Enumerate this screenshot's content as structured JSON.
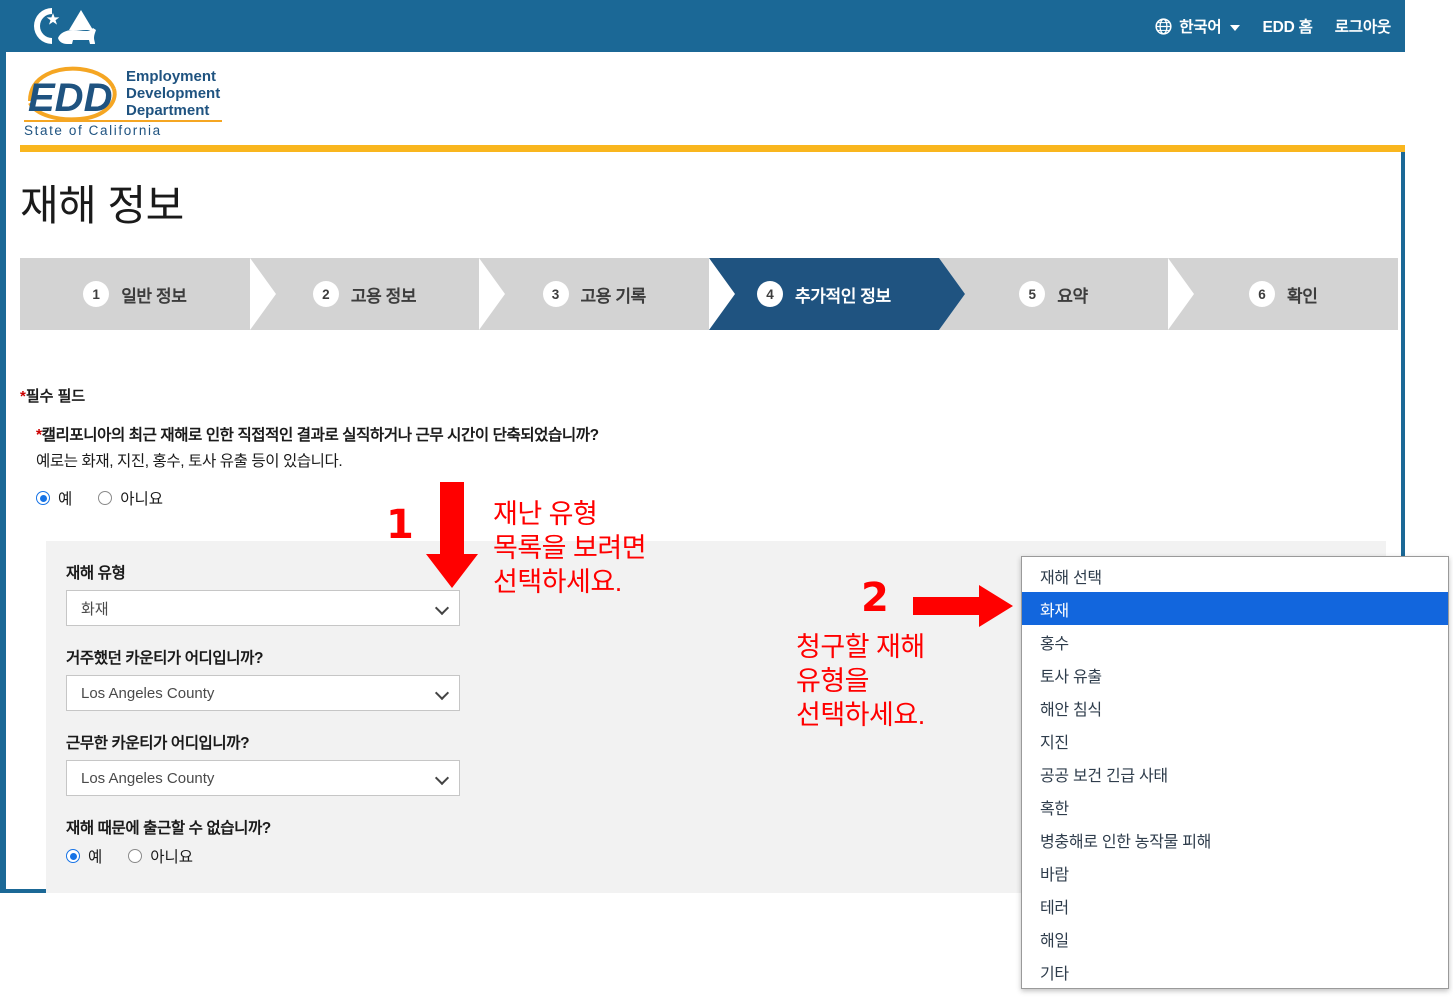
{
  "topnav": {
    "language": "한국어",
    "globe_icon": "globe-icon",
    "caret_icon": "chevron-down-icon",
    "home": "EDD 홈",
    "logout": "로그아웃"
  },
  "brand": {
    "ca_logo": "california-bear-logo",
    "edd_abbr": "EDD",
    "line1": "Employment",
    "line2": "Development",
    "line3": "Department",
    "line4": "State of California"
  },
  "page": {
    "title": "재해 정보"
  },
  "stepper": {
    "steps": [
      {
        "num": "1",
        "label": "일반 정보",
        "active": false
      },
      {
        "num": "2",
        "label": "고용 정보",
        "active": false
      },
      {
        "num": "3",
        "label": "고용 기록",
        "active": false
      },
      {
        "num": "4",
        "label": "추가적인 정보",
        "active": true
      },
      {
        "num": "5",
        "label": "요약",
        "active": false
      },
      {
        "num": "6",
        "label": "확인",
        "active": false
      }
    ]
  },
  "form": {
    "required_note": "필수 필드",
    "question": "캘리포니아의 최근 재해로 인한 직접적인 결과로 실직하거나 근무 시간이 단축되었습니까?",
    "question_sub": "예로는 화재, 지진, 홍수, 토사 유출 등이 있습니다.",
    "yes": "예",
    "no": "아니요",
    "disaster_type_label": "재해 유형",
    "disaster_type_value": "화재",
    "county_lived_label": "거주했던 카운티가 어디입니까?",
    "county_lived_value": "Los Angeles County",
    "county_worked_label": "근무한 카운티가 어디입니까?",
    "county_worked_value": "Los Angeles County",
    "cannot_work_label": "재해 때문에 출근할 수 없습니까?",
    "cannot_work_yes": "예",
    "cannot_work_no": "아니요"
  },
  "dropdown": {
    "options": [
      "재해 선택",
      "화재",
      "홍수",
      "토사 유출",
      "해안 침식",
      "지진",
      "공공 보건 긴급 사태",
      "혹한",
      "병충해로 인한 농작물 피해",
      "바람",
      "테러",
      "해일",
      "기타"
    ],
    "selected": "화재"
  },
  "annotations": [
    {
      "number": "1",
      "text": "재난 유형\n목록을 보려면\n선택하세요.",
      "arrow": "arrow-down"
    },
    {
      "number": "2",
      "text": "청구할 재해\n유형을\n선택하세요.",
      "arrow": "arrow-right"
    }
  ],
  "colors": {
    "header_blue": "#1b6896",
    "accent_gold": "#f9b61e",
    "step_active": "#1f5380",
    "step_inactive": "#d3d3d3",
    "annotation_red": "#ff0000",
    "dropdown_highlight": "#1266dd",
    "required_star": "#cc0000"
  }
}
